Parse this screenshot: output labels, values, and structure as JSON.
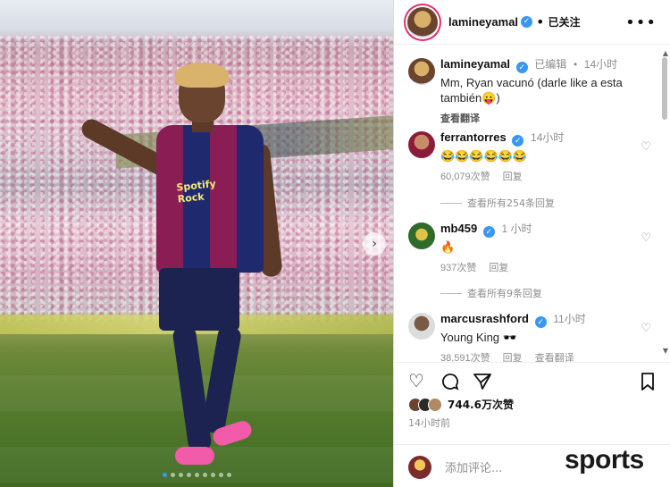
{
  "post": {
    "photo": {
      "shirt_text": "Spotify Rock",
      "slide_count": 9,
      "active_slide": 1
    },
    "header": {
      "username": "lamineyamal",
      "follow_status": "已关注",
      "more_icon": "more-horizontal-icon"
    },
    "caption": {
      "username": "lamineyamal",
      "edited": "已编辑",
      "time": "14小时",
      "text": "Mm, Ryan vacunó (darle like a esta también😛)",
      "translate": "查看翻译"
    },
    "comments": [
      {
        "username": "ferrantorres",
        "time": "14小时",
        "text": "😂😂😂😂😂😂",
        "likes": "60,079次赞",
        "reply": "回复",
        "view_replies": "查看所有254条回复"
      },
      {
        "username": "mb459",
        "time": "1 小时",
        "text": "🔥",
        "likes": "937次赞",
        "reply": "回复",
        "view_replies": "查看所有9条回复"
      },
      {
        "username": "marcusrashford",
        "time": "11小时",
        "text": "Young King 🕶️",
        "likes": "38,591次赞",
        "reply": "回复",
        "translate": "查看翻译"
      }
    ],
    "likes_count": "744.6万次赞",
    "posted_time": "14小时前",
    "comment_placeholder": "添加评论...",
    "watermark": "sports"
  }
}
